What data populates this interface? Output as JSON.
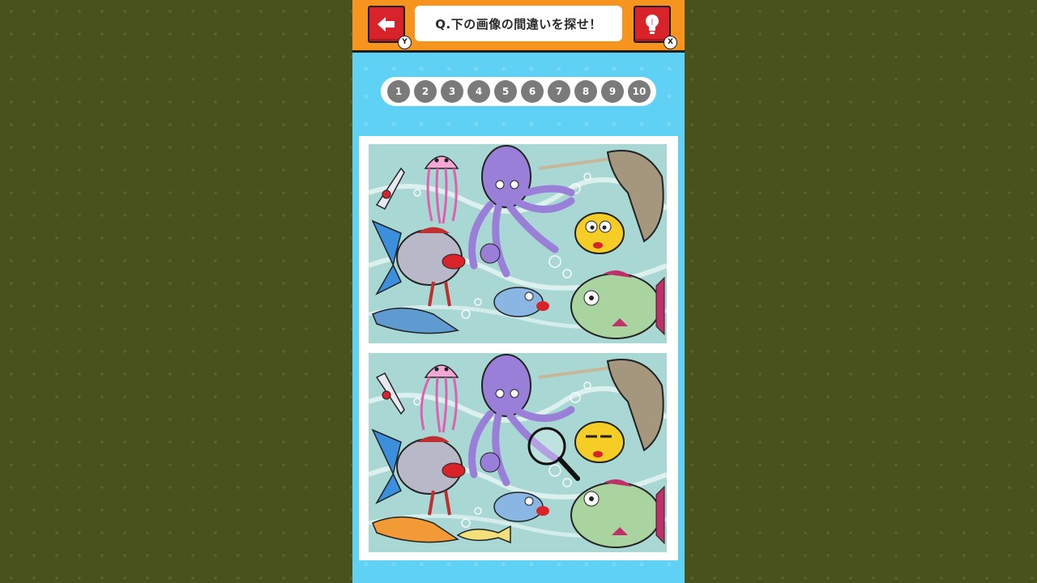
{
  "header": {
    "back_key": "Y",
    "hint_key": "X",
    "question": "Q.下の画像の間違いを探せ！"
  },
  "progress": {
    "items": [
      "1",
      "2",
      "3",
      "4",
      "5",
      "6",
      "7",
      "8",
      "9",
      "10"
    ],
    "found": 0
  },
  "colors": {
    "background": "#4a521c",
    "header": "#f7941d",
    "button_red": "#d9232a",
    "water": "#5ed1f4",
    "progress_dot": "#7a7a7a"
  },
  "icons": {
    "back": "arrow-left-icon",
    "hint": "lightbulb-icon",
    "magnifier": "magnifier-icon"
  }
}
